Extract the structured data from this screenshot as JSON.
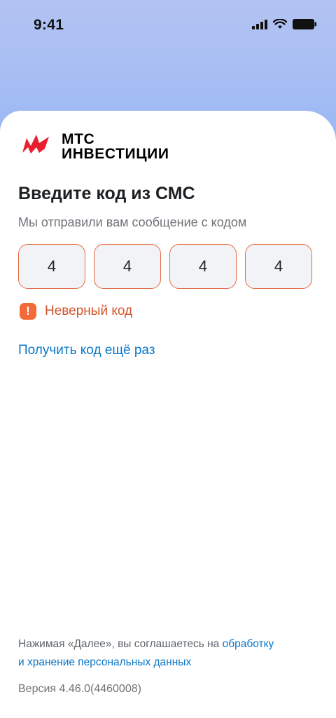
{
  "status_bar": {
    "time": "9:41"
  },
  "logo": {
    "line1": "МТС",
    "line2": "ИНВЕСТИЦИИ",
    "brand_color": "#e8202e"
  },
  "screen": {
    "title": "Введите код из СМС",
    "subtitle": "Мы отправили вам сообщение с кодом",
    "code_digits": [
      "4",
      "4",
      "4",
      "4"
    ],
    "error_text": "Неверный код",
    "resend_link": "Получить код ещё раз"
  },
  "footer": {
    "consent_prefix": "Нажимая «Далее», вы соглашаетесь на ",
    "consent_link_line1": "обработку",
    "consent_link_line2": "и хранение персональных данных",
    "version": "Версия 4.46.0(4460008)"
  },
  "colors": {
    "error": "#d2532a",
    "error_icon_bg": "#f36a38",
    "link": "#0a77c9",
    "code_border_error": "#e46a45"
  }
}
